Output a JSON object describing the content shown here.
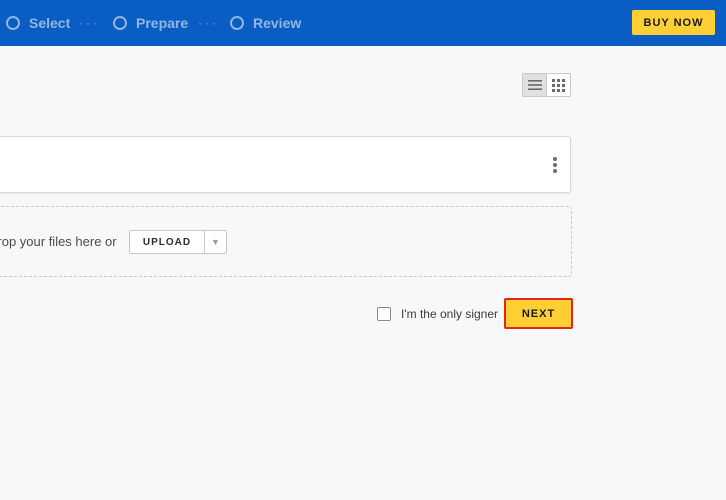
{
  "header": {
    "steps": [
      {
        "label": "Select"
      },
      {
        "label": "Prepare"
      },
      {
        "label": "Review"
      }
    ],
    "separator": "···",
    "buy_now_label": "BUY NOW",
    "colors": {
      "bar": "#0a5dc2",
      "accent": "#ffcf33"
    }
  },
  "toolbar": {
    "view_modes": [
      "list",
      "grid"
    ],
    "active_view": "list"
  },
  "upload": {
    "drop_text": "Drop your files here or",
    "upload_label": "UPLOAD"
  },
  "footer": {
    "only_signer_label": "I'm the only signer",
    "only_signer_checked": false,
    "next_label": "NEXT",
    "next_highlight_color": "#e4251b"
  }
}
